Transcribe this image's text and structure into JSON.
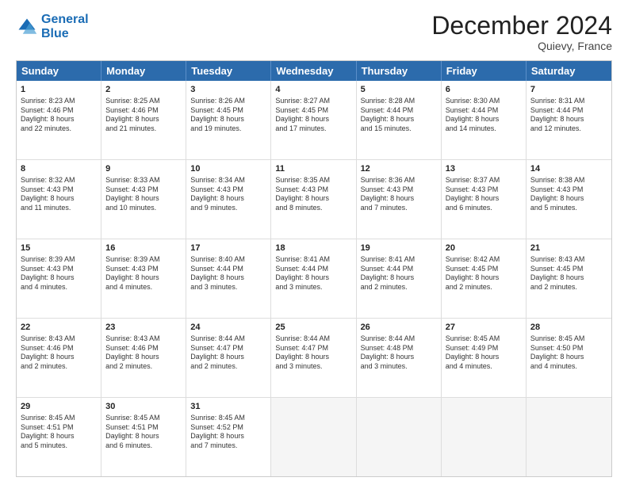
{
  "logo": {
    "line1": "General",
    "line2": "Blue"
  },
  "header": {
    "month": "December 2024",
    "location": "Quievy, France"
  },
  "weekdays": [
    "Sunday",
    "Monday",
    "Tuesday",
    "Wednesday",
    "Thursday",
    "Friday",
    "Saturday"
  ],
  "rows": [
    [
      {
        "day": "1",
        "lines": [
          "Sunrise: 8:23 AM",
          "Sunset: 4:46 PM",
          "Daylight: 8 hours",
          "and 22 minutes."
        ]
      },
      {
        "day": "2",
        "lines": [
          "Sunrise: 8:25 AM",
          "Sunset: 4:46 PM",
          "Daylight: 8 hours",
          "and 21 minutes."
        ]
      },
      {
        "day": "3",
        "lines": [
          "Sunrise: 8:26 AM",
          "Sunset: 4:45 PM",
          "Daylight: 8 hours",
          "and 19 minutes."
        ]
      },
      {
        "day": "4",
        "lines": [
          "Sunrise: 8:27 AM",
          "Sunset: 4:45 PM",
          "Daylight: 8 hours",
          "and 17 minutes."
        ]
      },
      {
        "day": "5",
        "lines": [
          "Sunrise: 8:28 AM",
          "Sunset: 4:44 PM",
          "Daylight: 8 hours",
          "and 15 minutes."
        ]
      },
      {
        "day": "6",
        "lines": [
          "Sunrise: 8:30 AM",
          "Sunset: 4:44 PM",
          "Daylight: 8 hours",
          "and 14 minutes."
        ]
      },
      {
        "day": "7",
        "lines": [
          "Sunrise: 8:31 AM",
          "Sunset: 4:44 PM",
          "Daylight: 8 hours",
          "and 12 minutes."
        ]
      }
    ],
    [
      {
        "day": "8",
        "lines": [
          "Sunrise: 8:32 AM",
          "Sunset: 4:43 PM",
          "Daylight: 8 hours",
          "and 11 minutes."
        ]
      },
      {
        "day": "9",
        "lines": [
          "Sunrise: 8:33 AM",
          "Sunset: 4:43 PM",
          "Daylight: 8 hours",
          "and 10 minutes."
        ]
      },
      {
        "day": "10",
        "lines": [
          "Sunrise: 8:34 AM",
          "Sunset: 4:43 PM",
          "Daylight: 8 hours",
          "and 9 minutes."
        ]
      },
      {
        "day": "11",
        "lines": [
          "Sunrise: 8:35 AM",
          "Sunset: 4:43 PM",
          "Daylight: 8 hours",
          "and 8 minutes."
        ]
      },
      {
        "day": "12",
        "lines": [
          "Sunrise: 8:36 AM",
          "Sunset: 4:43 PM",
          "Daylight: 8 hours",
          "and 7 minutes."
        ]
      },
      {
        "day": "13",
        "lines": [
          "Sunrise: 8:37 AM",
          "Sunset: 4:43 PM",
          "Daylight: 8 hours",
          "and 6 minutes."
        ]
      },
      {
        "day": "14",
        "lines": [
          "Sunrise: 8:38 AM",
          "Sunset: 4:43 PM",
          "Daylight: 8 hours",
          "and 5 minutes."
        ]
      }
    ],
    [
      {
        "day": "15",
        "lines": [
          "Sunrise: 8:39 AM",
          "Sunset: 4:43 PM",
          "Daylight: 8 hours",
          "and 4 minutes."
        ]
      },
      {
        "day": "16",
        "lines": [
          "Sunrise: 8:39 AM",
          "Sunset: 4:43 PM",
          "Daylight: 8 hours",
          "and 4 minutes."
        ]
      },
      {
        "day": "17",
        "lines": [
          "Sunrise: 8:40 AM",
          "Sunset: 4:44 PM",
          "Daylight: 8 hours",
          "and 3 minutes."
        ]
      },
      {
        "day": "18",
        "lines": [
          "Sunrise: 8:41 AM",
          "Sunset: 4:44 PM",
          "Daylight: 8 hours",
          "and 3 minutes."
        ]
      },
      {
        "day": "19",
        "lines": [
          "Sunrise: 8:41 AM",
          "Sunset: 4:44 PM",
          "Daylight: 8 hours",
          "and 2 minutes."
        ]
      },
      {
        "day": "20",
        "lines": [
          "Sunrise: 8:42 AM",
          "Sunset: 4:45 PM",
          "Daylight: 8 hours",
          "and 2 minutes."
        ]
      },
      {
        "day": "21",
        "lines": [
          "Sunrise: 8:43 AM",
          "Sunset: 4:45 PM",
          "Daylight: 8 hours",
          "and 2 minutes."
        ]
      }
    ],
    [
      {
        "day": "22",
        "lines": [
          "Sunrise: 8:43 AM",
          "Sunset: 4:46 PM",
          "Daylight: 8 hours",
          "and 2 minutes."
        ]
      },
      {
        "day": "23",
        "lines": [
          "Sunrise: 8:43 AM",
          "Sunset: 4:46 PM",
          "Daylight: 8 hours",
          "and 2 minutes."
        ]
      },
      {
        "day": "24",
        "lines": [
          "Sunrise: 8:44 AM",
          "Sunset: 4:47 PM",
          "Daylight: 8 hours",
          "and 2 minutes."
        ]
      },
      {
        "day": "25",
        "lines": [
          "Sunrise: 8:44 AM",
          "Sunset: 4:47 PM",
          "Daylight: 8 hours",
          "and 3 minutes."
        ]
      },
      {
        "day": "26",
        "lines": [
          "Sunrise: 8:44 AM",
          "Sunset: 4:48 PM",
          "Daylight: 8 hours",
          "and 3 minutes."
        ]
      },
      {
        "day": "27",
        "lines": [
          "Sunrise: 8:45 AM",
          "Sunset: 4:49 PM",
          "Daylight: 8 hours",
          "and 4 minutes."
        ]
      },
      {
        "day": "28",
        "lines": [
          "Sunrise: 8:45 AM",
          "Sunset: 4:50 PM",
          "Daylight: 8 hours",
          "and 4 minutes."
        ]
      }
    ],
    [
      {
        "day": "29",
        "lines": [
          "Sunrise: 8:45 AM",
          "Sunset: 4:51 PM",
          "Daylight: 8 hours",
          "and 5 minutes."
        ]
      },
      {
        "day": "30",
        "lines": [
          "Sunrise: 8:45 AM",
          "Sunset: 4:51 PM",
          "Daylight: 8 hours",
          "and 6 minutes."
        ]
      },
      {
        "day": "31",
        "lines": [
          "Sunrise: 8:45 AM",
          "Sunset: 4:52 PM",
          "Daylight: 8 hours",
          "and 7 minutes."
        ]
      },
      {
        "day": "",
        "lines": []
      },
      {
        "day": "",
        "lines": []
      },
      {
        "day": "",
        "lines": []
      },
      {
        "day": "",
        "lines": []
      }
    ]
  ]
}
